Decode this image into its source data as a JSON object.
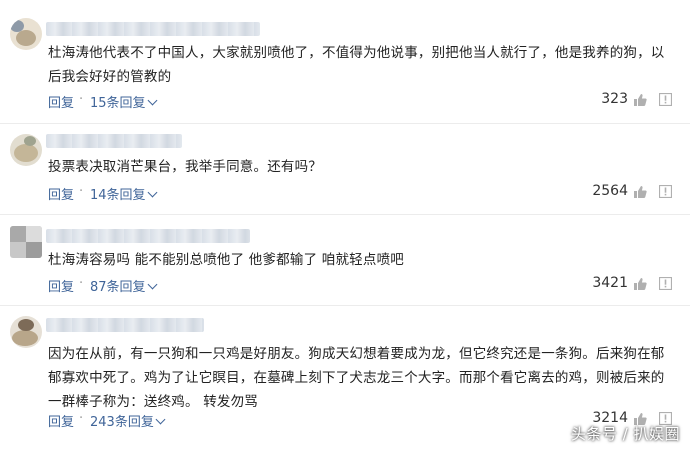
{
  "comments": [
    {
      "text": "杜海涛他代表不了中国人，大家就别喷他了，不值得为他说事，别把他当人就行了，他是我养的狗，以后我会好好的管教的",
      "reply_label": "回复",
      "separator": "·",
      "reply_count": "15条回复",
      "likes": "323"
    },
    {
      "text": "投票表决取消芒果台，我举手同意。还有吗？",
      "reply_label": "回复",
      "separator": "·",
      "reply_count": "14条回复",
      "likes": "2564"
    },
    {
      "text": "杜海涛容易吗 能不能别总喷他了 他爹都输了 咱就轻点喷吧",
      "reply_label": "回复",
      "separator": "·",
      "reply_count": "87条回复",
      "likes": "3421"
    },
    {
      "text": "因为在从前，有一只狗和一只鸡是好朋友。狗成天幻想着要成为龙，但它终究还是一条狗。后来狗在郁郁寡欢中死了。鸡为了让它瞑目，在墓碑上刻下了犬志龙三个大字。而那个看它离去的鸡，则被后来的一群棒子称为：送终鸡。 转发勿骂",
      "reply_label": "回复",
      "separator": "·",
      "reply_count": "243条回复",
      "likes": "3214"
    }
  ],
  "watermark": "头条号 / 扒娱圈",
  "colors": {
    "link": "#406599",
    "text": "#222222",
    "divider": "#ececec"
  },
  "icons": [
    "thumb-up-icon",
    "report-icon",
    "chevron-down-icon"
  ]
}
